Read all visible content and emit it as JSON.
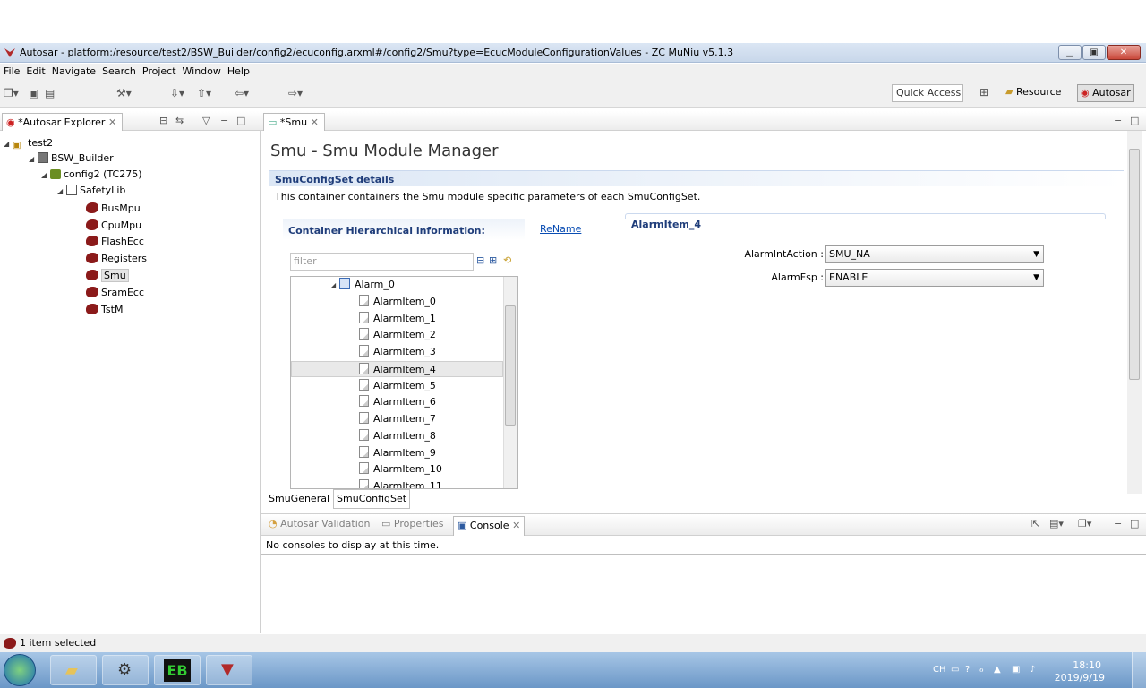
{
  "window": {
    "title": "Autosar - platform:/resource/test2/BSW_Builder/config2/ecuconfig.arxml#/config2/Smu?type=EcucModuleConfigurationValues - ZC MuNiu v5.1.3",
    "min": "▁",
    "max": "▣",
    "close": "✕"
  },
  "menu": [
    "File",
    "Edit",
    "Navigate",
    "Search",
    "Project",
    "Window",
    "Help"
  ],
  "toolbar": {
    "quick_access": "Quick Access",
    "persp_resource": "Resource",
    "persp_autosar": "Autosar"
  },
  "explorer": {
    "tab": "*Autosar Explorer",
    "tree": [
      {
        "label": "test2",
        "depth": 0
      },
      {
        "label": "BSW_Builder",
        "depth": 1
      },
      {
        "label": "config2 (TC275)",
        "depth": 2
      },
      {
        "label": "SafetyLib",
        "depth": 3
      },
      {
        "label": "BusMpu",
        "depth": 4
      },
      {
        "label": "CpuMpu",
        "depth": 4
      },
      {
        "label": "FlashEcc",
        "depth": 4
      },
      {
        "label": "Registers",
        "depth": 4
      },
      {
        "label": "Smu",
        "depth": 4
      },
      {
        "label": "SramEcc",
        "depth": 4
      },
      {
        "label": "TstM",
        "depth": 4
      }
    ]
  },
  "editor": {
    "tab": "*Smu",
    "page_title": "Smu - Smu Module Manager",
    "section_title": "SmuConfigSet details",
    "section_desc": "This container containers the Smu module specific parameters of each SmuConfigSet.",
    "hier_label": "Container Hierarchical information:",
    "rename": "ReName",
    "filter_placeholder": "filter",
    "detail_title": "AlarmItem_4",
    "alarm_tree": [
      "Alarm_0",
      "AlarmItem_0",
      "AlarmItem_1",
      "AlarmItem_2",
      "AlarmItem_3",
      "AlarmItem_4",
      "AlarmItem_5",
      "AlarmItem_6",
      "AlarmItem_7",
      "AlarmItem_8",
      "AlarmItem_9",
      "AlarmItem_10",
      "AlarmItem_11"
    ],
    "props": [
      {
        "label": "AlarmIntAction :",
        "value": "SMU_NA"
      },
      {
        "label": "AlarmFsp :",
        "value": "ENABLE"
      }
    ],
    "page_tabs": [
      "SmuGeneral",
      "SmuConfigSet"
    ]
  },
  "console": {
    "tabs": [
      "Autosar Validation",
      "Properties",
      "Console"
    ],
    "message": "No consoles to display at this time."
  },
  "status": {
    "text": "1 item selected"
  },
  "taskbar": {
    "time": "18:10",
    "date": "2019/9/19",
    "lang": "CH",
    "tile_eb": "EB"
  }
}
